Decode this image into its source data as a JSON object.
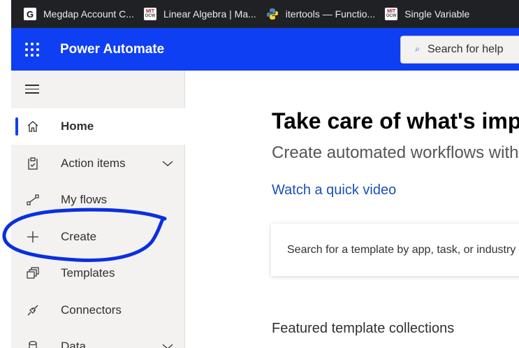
{
  "bookmarks": [
    {
      "label": "Megdap Account C...",
      "icon": "g-logo-icon"
    },
    {
      "label": "Linear Algebra | Ma...",
      "icon": "mit-ocw-icon"
    },
    {
      "label": "itertools — Functio...",
      "icon": "python-icon"
    },
    {
      "label": "Single Variable",
      "icon": "mit-ocw-icon"
    }
  ],
  "mit_icon": {
    "line1": "MIT",
    "line2": "OCW"
  },
  "g_icon": {
    "letter": "G"
  },
  "app": {
    "title": "Power Automate",
    "accent": "#0f3ff2"
  },
  "search": {
    "placeholder": "Search for help"
  },
  "sidebar": {
    "items": [
      {
        "label": "Home",
        "icon": "home-icon",
        "active": true
      },
      {
        "label": "Action items",
        "icon": "clipboard-icon",
        "expandable": true
      },
      {
        "label": "My flows",
        "icon": "flow-icon"
      },
      {
        "label": "Create",
        "icon": "plus-icon"
      },
      {
        "label": "Templates",
        "icon": "templates-icon"
      },
      {
        "label": "Connectors",
        "icon": "connector-icon"
      },
      {
        "label": "Data",
        "icon": "database-icon",
        "expandable": true
      }
    ]
  },
  "main": {
    "headline": "Take care of what's imp",
    "subhead": "Create automated workflows with",
    "video_link": "Watch a quick video",
    "template_search_placeholder": "Search for a template by app, task, or industry",
    "featured_title": "Featured template collections"
  },
  "annotation": {
    "color": "#0a2fe0"
  }
}
